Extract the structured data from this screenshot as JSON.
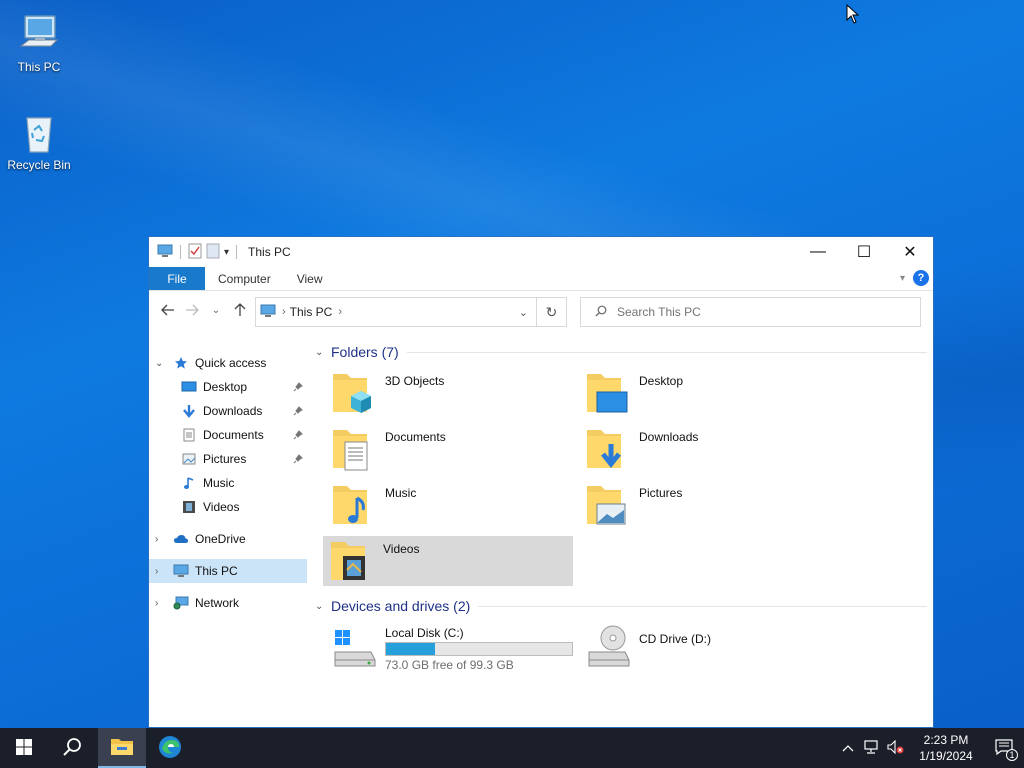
{
  "desktop": {
    "icons": [
      {
        "label": "This PC",
        "icon": "computer-icon"
      },
      {
        "label": "Recycle Bin",
        "icon": "recycle-bin-icon"
      }
    ]
  },
  "window": {
    "title": "This PC",
    "controls": {
      "minimize": "—",
      "maximize": "☐",
      "close": "✕"
    },
    "ribbon": {
      "tabs": [
        "File",
        "Computer",
        "View"
      ],
      "accent": "#1979ca"
    },
    "address": {
      "crumbs": [
        "This PC"
      ]
    },
    "search": {
      "placeholder": "Search This PC"
    },
    "sidebar": {
      "quick_access": {
        "label": "Quick access",
        "items": [
          {
            "label": "Desktop",
            "icon": "desktop-icon",
            "pinned": true
          },
          {
            "label": "Downloads",
            "icon": "download-icon",
            "pinned": true
          },
          {
            "label": "Documents",
            "icon": "document-icon",
            "pinned": true
          },
          {
            "label": "Pictures",
            "icon": "picture-icon",
            "pinned": true
          },
          {
            "label": "Music",
            "icon": "music-icon",
            "pinned": false
          },
          {
            "label": "Videos",
            "icon": "video-icon",
            "pinned": false
          }
        ]
      },
      "roots": [
        {
          "label": "OneDrive",
          "icon": "cloud-icon"
        },
        {
          "label": "This PC",
          "icon": "computer-icon",
          "selected": true
        },
        {
          "label": "Network",
          "icon": "network-icon"
        }
      ]
    },
    "content": {
      "folders_header": "Folders (7)",
      "folders": [
        {
          "label": "3D Objects",
          "icon": "3d-objects-folder-icon"
        },
        {
          "label": "Desktop",
          "icon": "desktop-folder-icon"
        },
        {
          "label": "Documents",
          "icon": "documents-folder-icon"
        },
        {
          "label": "Downloads",
          "icon": "downloads-folder-icon"
        },
        {
          "label": "Music",
          "icon": "music-folder-icon"
        },
        {
          "label": "Pictures",
          "icon": "pictures-folder-icon"
        },
        {
          "label": "Videos",
          "icon": "videos-folder-icon",
          "hovered": true
        }
      ],
      "devices_header": "Devices and drives (2)",
      "drives": [
        {
          "label": "Local Disk (C:)",
          "free_text": "73.0 GB free of 99.3 GB",
          "used_fraction": 0.265,
          "icon": "hard-disk-icon"
        },
        {
          "label": "CD Drive (D:)",
          "icon": "cd-drive-icon"
        }
      ]
    }
  },
  "taskbar": {
    "buttons": [
      {
        "icon": "windows-start-icon"
      },
      {
        "icon": "search-icon"
      },
      {
        "icon": "file-explorer-icon",
        "active": true
      },
      {
        "icon": "edge-browser-icon"
      }
    ],
    "tray": {
      "time": "2:23 PM",
      "date": "1/19/2024",
      "notification_count": "1"
    }
  }
}
